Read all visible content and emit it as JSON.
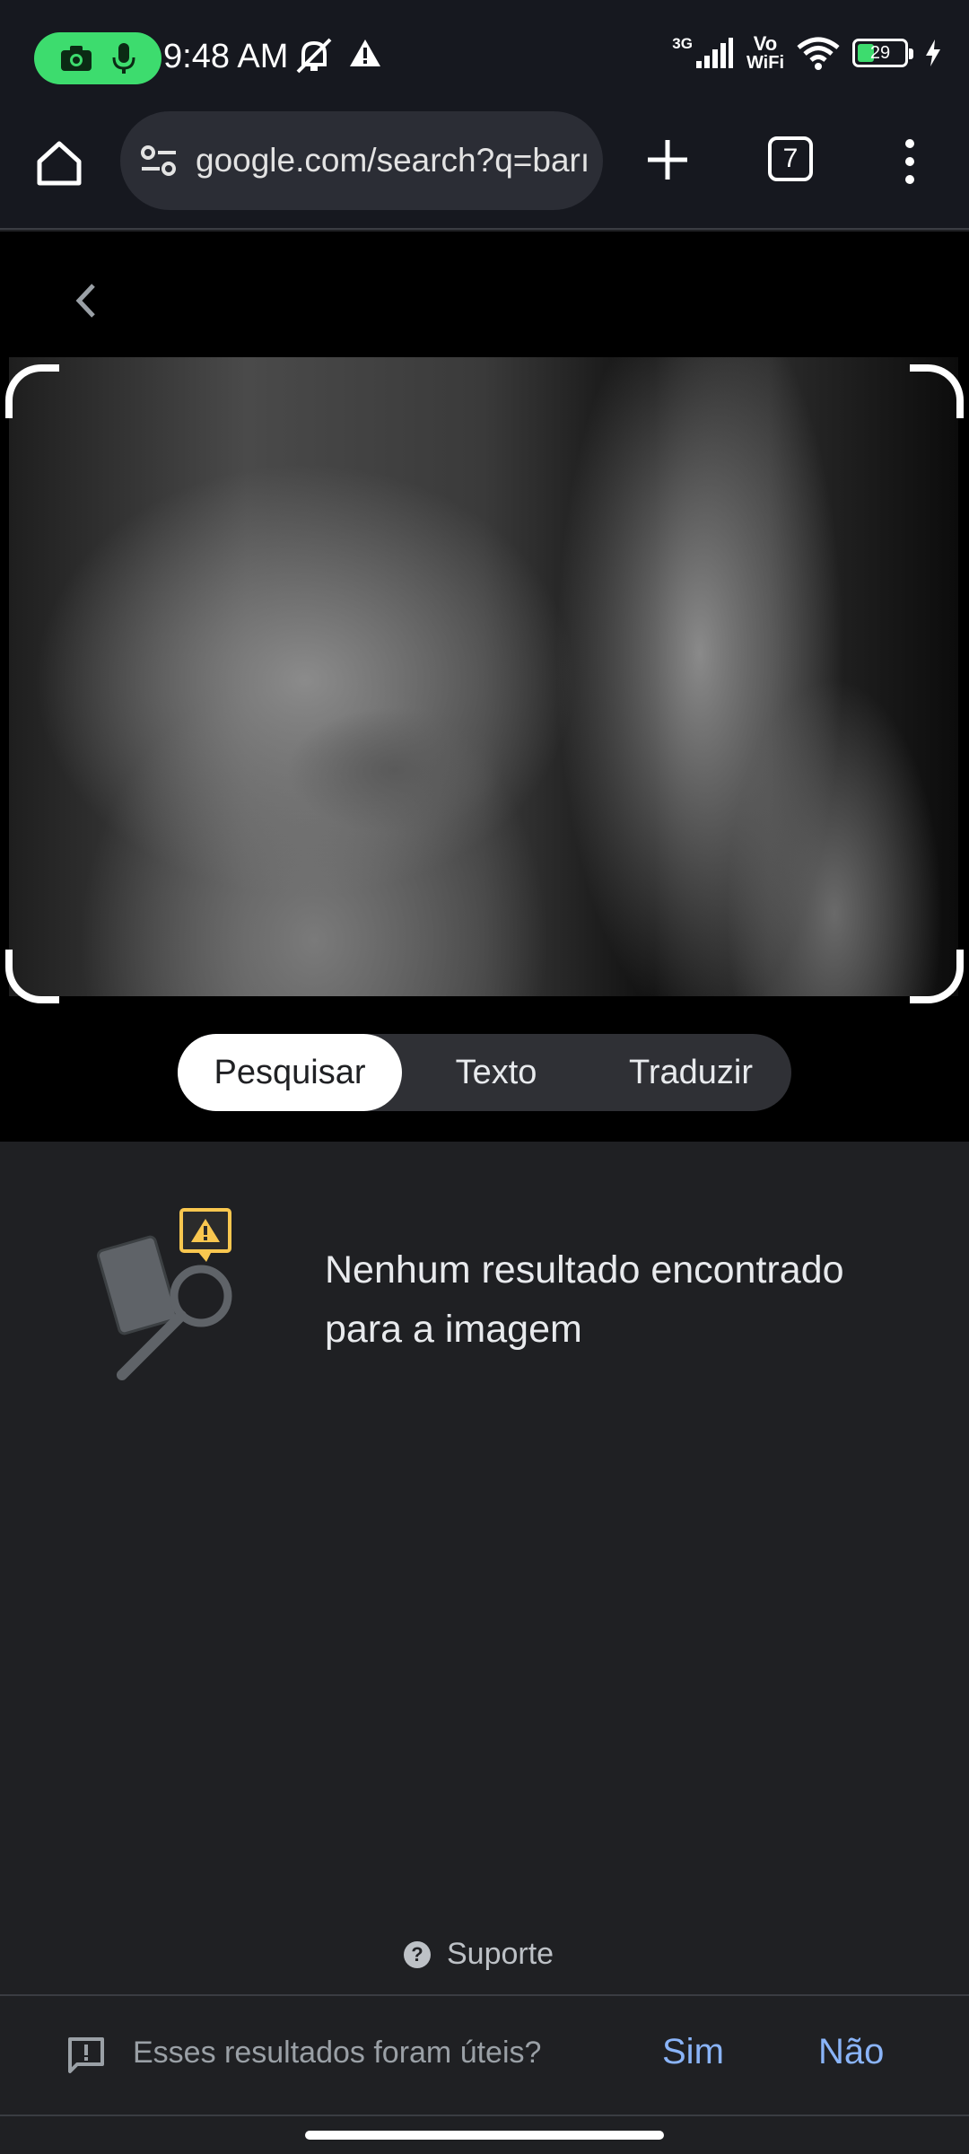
{
  "status_bar": {
    "time": "9:48 AM",
    "network": "3G",
    "volte": "Vo",
    "wifi_label": "WiFi",
    "battery_level": "29",
    "icons": [
      "camera-icon",
      "mic-icon",
      "mute-icon",
      "alert-icon",
      "signal-icon",
      "wifi-icon",
      "battery-icon",
      "charging-icon"
    ]
  },
  "toolbar": {
    "url": "google.com/search?q=barı",
    "tab_count": "7"
  },
  "lens": {
    "modes": [
      "Pesquisar",
      "Texto",
      "Traduzir"
    ],
    "active_mode": "Pesquisar"
  },
  "results": {
    "empty_message": "Nenhum resultado encontrado para a imagem"
  },
  "footer": {
    "support_label": "Suporte",
    "feedback_question": "Esses resultados foram úteis?",
    "yes_label": "Sim",
    "no_label": "Não"
  },
  "colors": {
    "accent_green": "#3ddc6e",
    "link_blue": "#8ab4f8",
    "warning_yellow": "#f9c74f"
  }
}
